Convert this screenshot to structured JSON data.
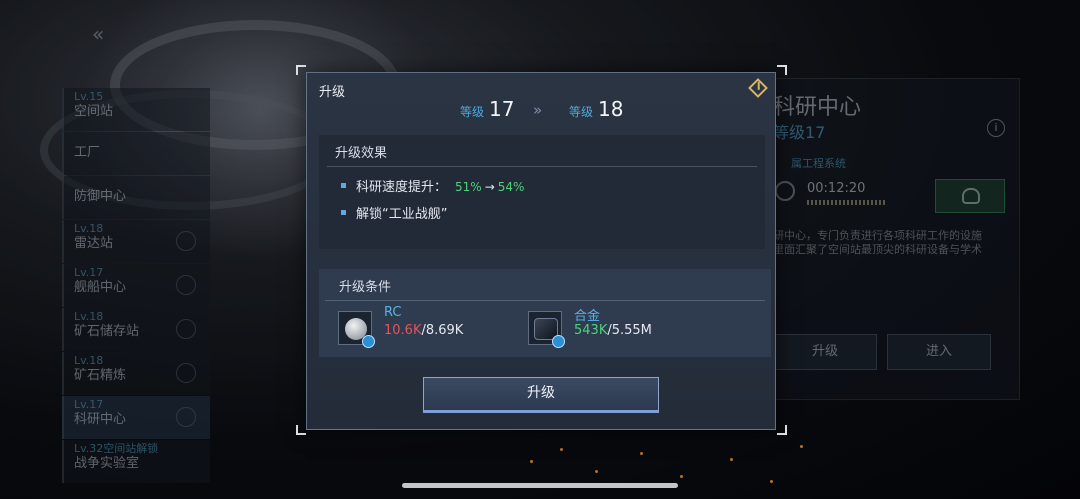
{
  "background": {
    "back_icon": "chevron-double-left-icon",
    "left_list": [
      {
        "level": "Lv.15",
        "name": "空间站"
      },
      {
        "level": "",
        "name": "工厂"
      },
      {
        "level": "",
        "name": "防御中心"
      },
      {
        "level": "Lv.18",
        "name": "雷达站"
      },
      {
        "level": "Lv.17",
        "name": "舰船中心"
      },
      {
        "level": "Lv.18",
        "name": "矿石储存站"
      },
      {
        "level": "Lv.18",
        "name": "矿石精炼"
      },
      {
        "level": "Lv.17",
        "name": "科研中心"
      },
      {
        "level": "Lv.32空间站解锁",
        "name": "战争实验室"
      }
    ],
    "right_panel": {
      "title": "科研中心",
      "level": "等级17",
      "system": "属工程系统",
      "timer": "00:12:20",
      "description": "研中心，专门负责进行各项科研工作的设施\n里面汇聚了空间站最顶尖的科研设备与学术",
      "upgrade_label": "升级",
      "enter_label": "进入"
    }
  },
  "modal": {
    "title": "升级",
    "close_icon": "diamond-close-icon",
    "level_label": "等级",
    "from_level": "17",
    "to_level": "18",
    "arrow": "»",
    "effects_header": "升级效果",
    "effects": [
      {
        "text": "科研速度提升：",
        "from": "51%",
        "arrow": "→",
        "to": "54%"
      },
      {
        "text": "解锁“工业战舰”",
        "from": "",
        "arrow": "",
        "to": ""
      }
    ],
    "conditions_header": "升级条件",
    "resources": [
      {
        "name": "RC",
        "have": "10.6K",
        "need": "/8.69K",
        "status": "short",
        "icon": "rc-coin-icon"
      },
      {
        "name": "合金",
        "have": "543K",
        "need": "/5.55M",
        "status": "ok",
        "icon": "alloy-icon"
      }
    ],
    "upgrade_button": "升级"
  },
  "colors": {
    "accent_blue": "#4fa8dc",
    "ok_green": "#4fd27a",
    "short_red": "#e0565c"
  }
}
